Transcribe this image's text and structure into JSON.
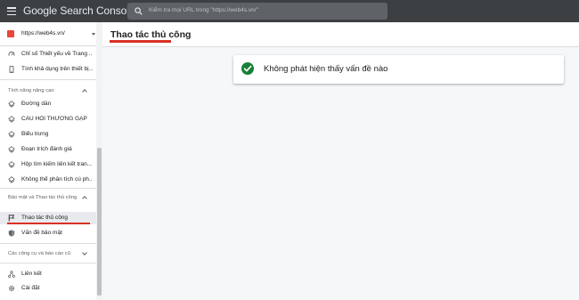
{
  "topbar": {
    "brand": "Google Search Console",
    "search_placeholder": "Kiểm tra mọi URL trong \"https://web4s.vn/\""
  },
  "property": {
    "label": "https://web4s.vn/"
  },
  "sidebar": {
    "top_items": [
      {
        "label": "Chỉ số Thiết yếu về Trang ...",
        "icon": "speed-gauge-icon"
      },
      {
        "label": "Tính khả dụng trên thiết bị...",
        "icon": "mobile-phone-icon"
      }
    ],
    "enhancements": {
      "label": "Tính năng nâng cao",
      "items": [
        {
          "label": "Đường dẫn",
          "icon": "diamond-layers-icon"
        },
        {
          "label": "CÂU HỎI THƯỜNG GẶP",
          "icon": "diamond-layers-icon"
        },
        {
          "label": "Biểu trưng",
          "icon": "diamond-layers-icon"
        },
        {
          "label": "Đoạn trích đánh giá",
          "icon": "diamond-layers-icon"
        },
        {
          "label": "Hộp tìm kiếm liên kết tran...",
          "icon": "diamond-layers-icon"
        },
        {
          "label": "Không thể phân tích cú ph...",
          "icon": "diamond-layers-icon"
        }
      ]
    },
    "security": {
      "label": "Bảo mật và Thao tác thủ công",
      "items": [
        {
          "label": "Thao tác thủ công",
          "icon": "flag-icon",
          "active": true
        },
        {
          "label": "Vấn đề bảo mật",
          "icon": "shield-icon"
        }
      ]
    },
    "legacy": {
      "label": "Các công cụ và báo cáo cũ"
    },
    "bottom_items": [
      {
        "label": "Liên kết",
        "icon": "links-network-icon"
      },
      {
        "label": "Cài đặt",
        "icon": "gear-icon"
      }
    ]
  },
  "main": {
    "title": "Thao tác thủ công",
    "status_message": "Không phát hiện thấy vấn đề nào"
  },
  "colors": {
    "topbar_bg": "#3c4043",
    "accent_red": "#d93025",
    "success_green": "#188038",
    "property_icon": "#e8453c"
  }
}
